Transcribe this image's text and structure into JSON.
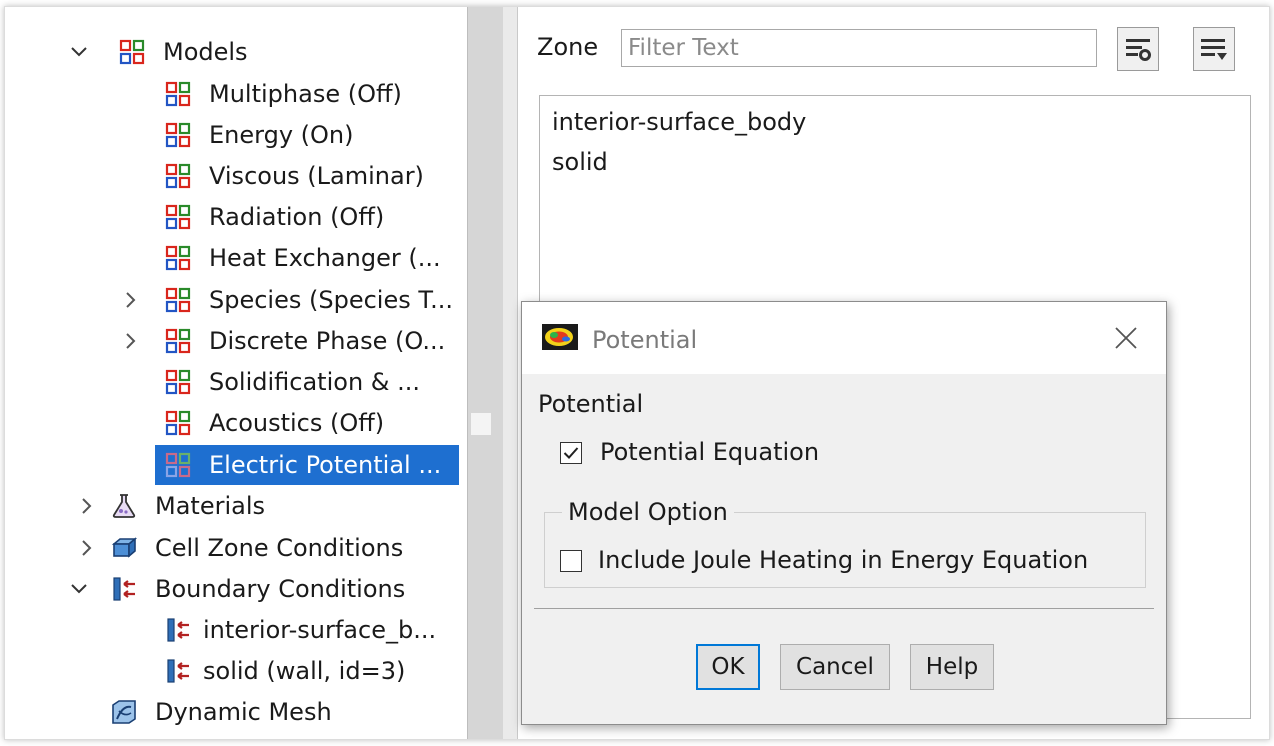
{
  "tree": {
    "models": {
      "label": "Models"
    },
    "model_items": [
      {
        "label": "Multiphase (Off)"
      },
      {
        "label": "Energy (On)"
      },
      {
        "label": "Viscous (Laminar)"
      },
      {
        "label": "Radiation (Off)"
      },
      {
        "label": "Heat Exchanger (..."
      },
      {
        "label": "Species (Species T..."
      },
      {
        "label": "Discrete Phase (O..."
      },
      {
        "label": "Solidification & ..."
      },
      {
        "label": "Acoustics (Off)"
      },
      {
        "label": "Electric Potential ..."
      }
    ],
    "materials": {
      "label": "Materials"
    },
    "cell_zone": {
      "label": "Cell Zone Conditions"
    },
    "boundary": {
      "label": "Boundary Conditions"
    },
    "boundary_items": [
      {
        "label": "interior-surface_b..."
      },
      {
        "label": "solid (wall, id=3)"
      }
    ],
    "dynamic_mesh": {
      "label": "Dynamic Mesh"
    }
  },
  "zone_panel": {
    "label": "Zone",
    "filter_placeholder": "Filter Text",
    "items": [
      "interior-surface_body",
      "solid"
    ]
  },
  "dialog": {
    "title": "Potential",
    "section_heading": "Potential",
    "potential_equation": {
      "label": "Potential Equation",
      "checked": true
    },
    "model_option": {
      "title": "Model Option",
      "joule_heating": {
        "label": "Include Joule Heating in Energy Equation",
        "checked": false
      }
    },
    "buttons": {
      "ok": "OK",
      "cancel": "Cancel",
      "help": "Help"
    }
  },
  "colors": {
    "selection": "#1e6fd0",
    "dialog_bg": "#f0f0f0",
    "default_button_border": "#0078d7"
  }
}
